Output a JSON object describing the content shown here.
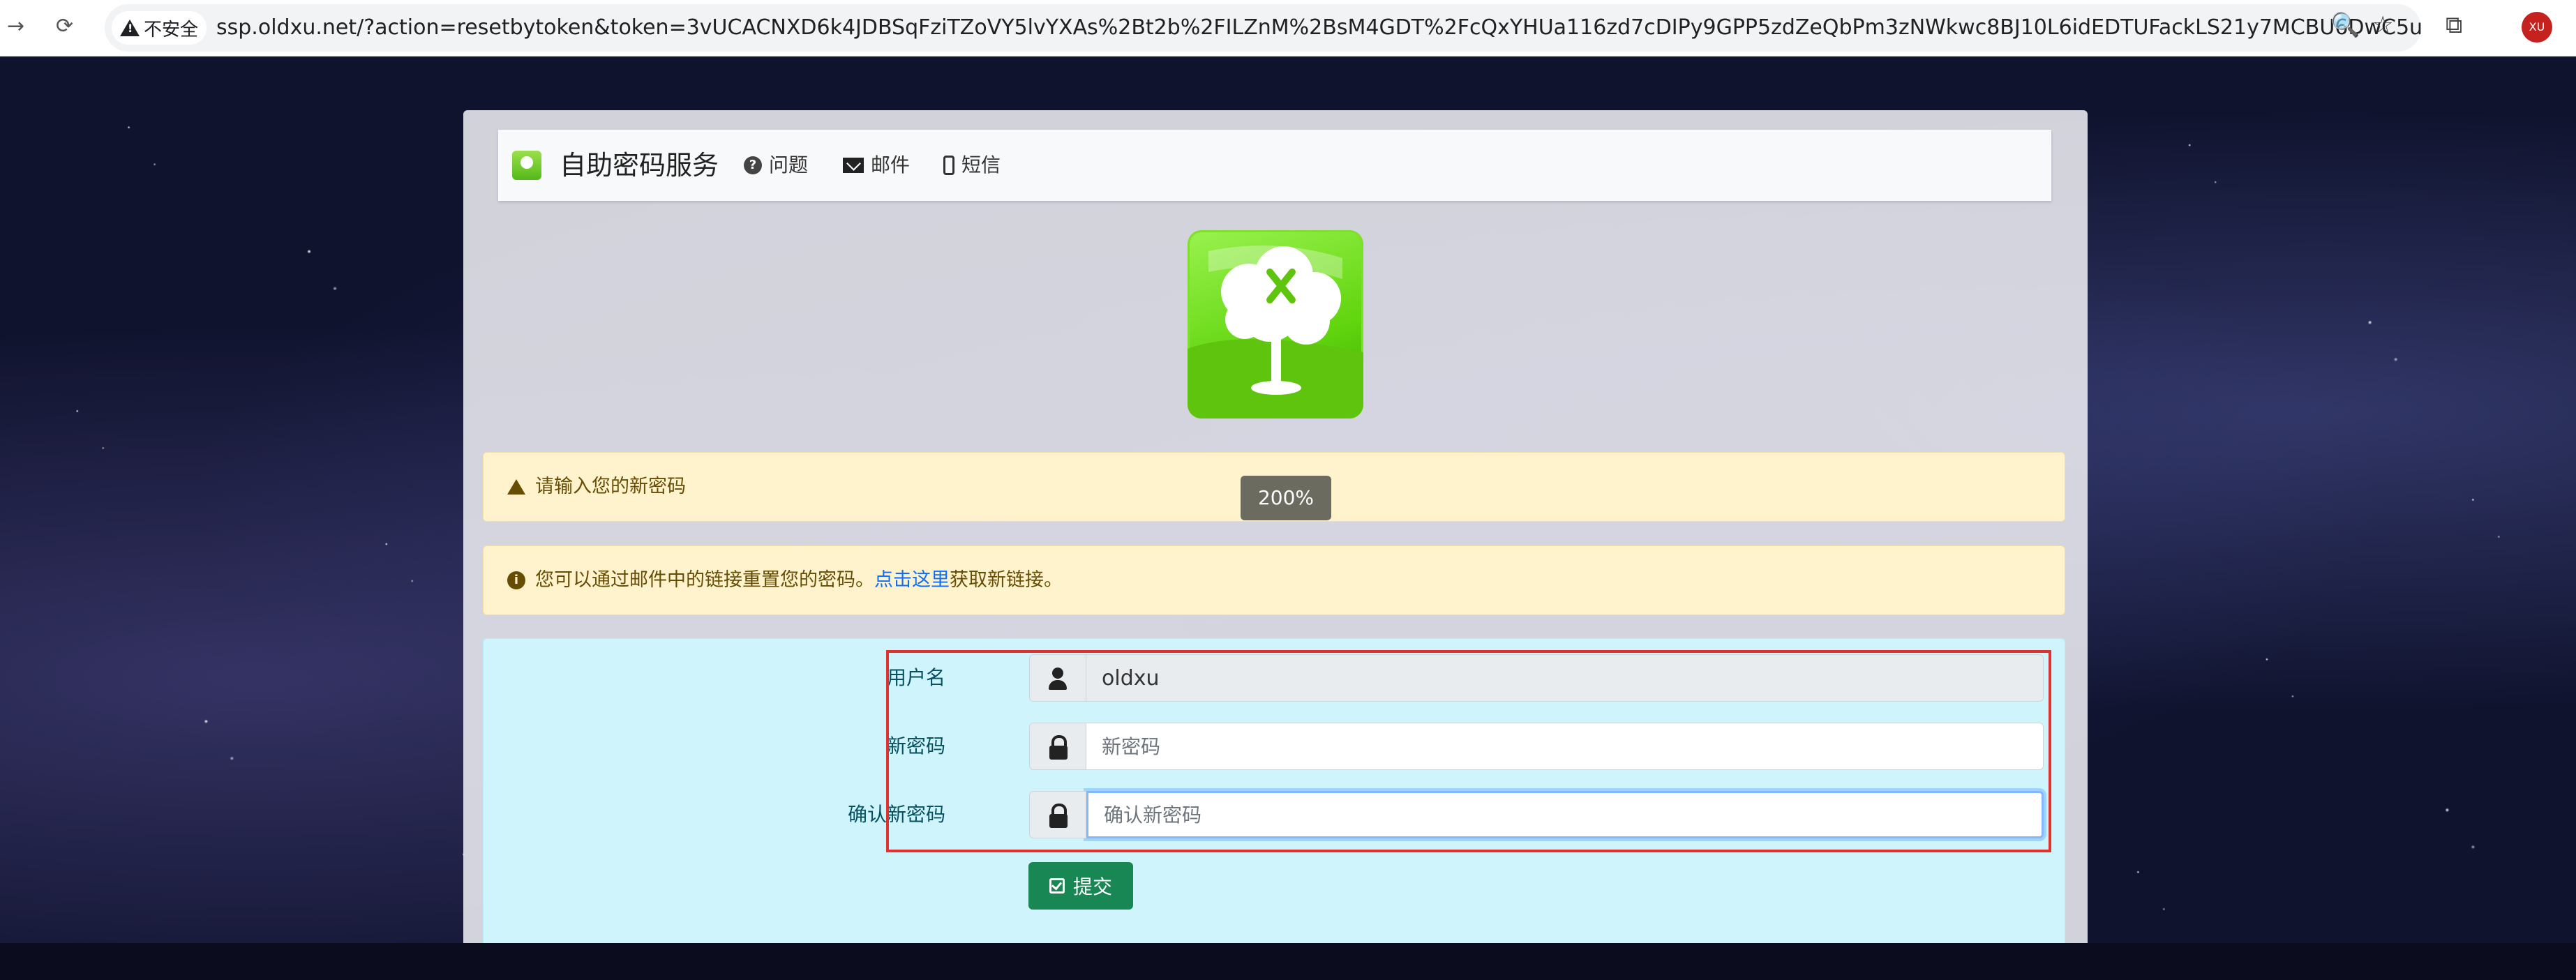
{
  "browser": {
    "back": "→",
    "reload": "⟳",
    "security_label": "不安全",
    "url": "ssp.oldxu.net/?action=resetbytoken&token=3vUCACNXD6k4JDBSqFziTZoVY5lvYXAs%2Bt2b%2FILZnM%2BsM4GDT%2FcQxYHUa116zd7cDIPy9GPP5zdZeQbPm3zNWkwc8BJ10L6idEDTUFackLS21y7MCBU6DwC5uEAktDglBp...",
    "zoom_icon": "🔍",
    "star_icon": "☆",
    "extensions_icon": "⧉",
    "profile_initials": "XU"
  },
  "navbar": {
    "title": "自助密码服务",
    "links": [
      {
        "label": "问题",
        "icon": "question-circle-icon"
      },
      {
        "label": "邮件",
        "icon": "envelope-icon"
      },
      {
        "label": "短信",
        "icon": "mobile-icon"
      }
    ]
  },
  "alerts": {
    "warning": "请输入您的新密码",
    "info_prefix": "您可以通过邮件中的链接重置您的密码。",
    "info_link": "点击这里",
    "info_suffix": "获取新链接。"
  },
  "zoom_badge": "200%",
  "form": {
    "username_label": "用户名",
    "username_value": "oldxu",
    "new_password_label": "新密码",
    "new_password_placeholder": "新密码",
    "confirm_password_label": "确认新密码",
    "confirm_password_placeholder": "确认新密码",
    "submit_label": "提交"
  },
  "colors": {
    "accent_submit": "#198754",
    "alert_bg": "#fff3cd",
    "form_bg": "#cff4fc",
    "highlight": "#e03131"
  }
}
